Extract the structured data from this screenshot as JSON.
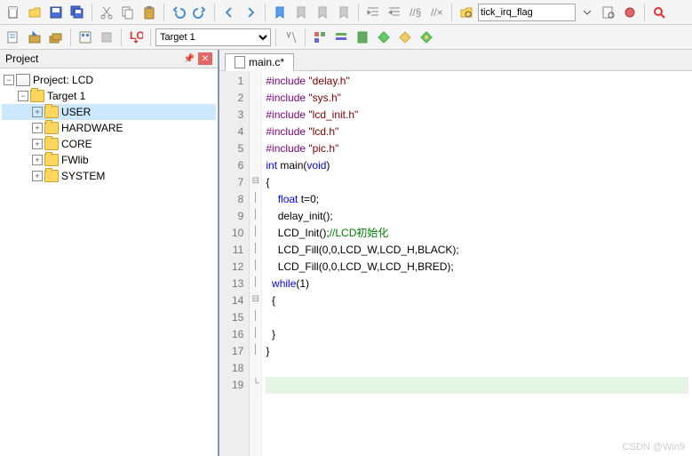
{
  "toolbar": {
    "search_value": "tick_irq_flag",
    "target_value": "Target 1"
  },
  "project_panel": {
    "title": "Project",
    "root_label": "Project: LCD",
    "target_label": "Target 1",
    "folders": [
      {
        "label": "USER",
        "selected": true
      },
      {
        "label": "HARDWARE",
        "selected": false
      },
      {
        "label": "CORE",
        "selected": false
      },
      {
        "label": "FWlib",
        "selected": false
      },
      {
        "label": "SYSTEM",
        "selected": false
      }
    ]
  },
  "editor": {
    "tab_label": "main.c*",
    "lines": [
      {
        "n": 1,
        "fold": "",
        "tokens": [
          {
            "t": "#include ",
            "c": "kw-pre"
          },
          {
            "t": "\"delay.h\"",
            "c": "kw-str"
          }
        ]
      },
      {
        "n": 2,
        "fold": "",
        "tokens": [
          {
            "t": "#include ",
            "c": "kw-pre"
          },
          {
            "t": "\"sys.h\"",
            "c": "kw-str"
          }
        ]
      },
      {
        "n": 3,
        "fold": "",
        "tokens": [
          {
            "t": "#include ",
            "c": "kw-pre"
          },
          {
            "t": "\"lcd_init.h\"",
            "c": "kw-str"
          }
        ]
      },
      {
        "n": 4,
        "fold": "",
        "tokens": [
          {
            "t": "#include ",
            "c": "kw-pre"
          },
          {
            "t": "\"lcd.h\"",
            "c": "kw-str"
          }
        ]
      },
      {
        "n": 5,
        "fold": "",
        "tokens": [
          {
            "t": "#include ",
            "c": "kw-pre"
          },
          {
            "t": "\"pic.h\"",
            "c": "kw-str"
          }
        ]
      },
      {
        "n": 6,
        "fold": "",
        "tokens": [
          {
            "t": "int",
            "c": "kw-blue"
          },
          {
            "t": " main(",
            "c": "kw-txt"
          },
          {
            "t": "void",
            "c": "kw-blue"
          },
          {
            "t": ")",
            "c": "kw-txt"
          }
        ]
      },
      {
        "n": 7,
        "fold": "⊟",
        "tokens": [
          {
            "t": "{",
            "c": "kw-txt"
          }
        ]
      },
      {
        "n": 8,
        "fold": "│",
        "tokens": [
          {
            "t": "    ",
            "c": "kw-txt"
          },
          {
            "t": "float",
            "c": "kw-blue"
          },
          {
            "t": " t=0;",
            "c": "kw-txt"
          }
        ]
      },
      {
        "n": 9,
        "fold": "│",
        "tokens": [
          {
            "t": "    delay_init();",
            "c": "kw-txt"
          }
        ]
      },
      {
        "n": 10,
        "fold": "│",
        "tokens": [
          {
            "t": "    LCD_Init();",
            "c": "kw-txt"
          },
          {
            "t": "//LCD初始化",
            "c": "kw-cmt"
          }
        ]
      },
      {
        "n": 11,
        "fold": "│",
        "tokens": [
          {
            "t": "    LCD_Fill(0,0,LCD_W,LCD_H,BLACK);",
            "c": "kw-txt"
          }
        ]
      },
      {
        "n": 12,
        "fold": "│",
        "tokens": [
          {
            "t": "    LCD_Fill(0,0,LCD_W,LCD_H,BRED);",
            "c": "kw-txt"
          }
        ]
      },
      {
        "n": 13,
        "fold": "│",
        "tokens": [
          {
            "t": "  ",
            "c": "kw-txt"
          },
          {
            "t": "while",
            "c": "kw-blue"
          },
          {
            "t": "(1)",
            "c": "kw-txt"
          }
        ]
      },
      {
        "n": 14,
        "fold": "⊟",
        "tokens": [
          {
            "t": "  {",
            "c": "kw-txt"
          }
        ]
      },
      {
        "n": 15,
        "fold": "│",
        "tokens": [
          {
            "t": "",
            "c": "kw-txt"
          }
        ]
      },
      {
        "n": 16,
        "fold": "│",
        "tokens": [
          {
            "t": "  }",
            "c": "kw-txt"
          }
        ]
      },
      {
        "n": 17,
        "fold": "│",
        "tokens": [
          {
            "t": "}",
            "c": "kw-txt"
          }
        ]
      },
      {
        "n": 18,
        "fold": "",
        "tokens": [
          {
            "t": "",
            "c": "kw-txt"
          }
        ]
      },
      {
        "n": 19,
        "fold": "└",
        "tokens": [
          {
            "t": "",
            "c": "kw-txt"
          }
        ],
        "current": true
      }
    ]
  },
  "watermark": "CSDN @Win9"
}
